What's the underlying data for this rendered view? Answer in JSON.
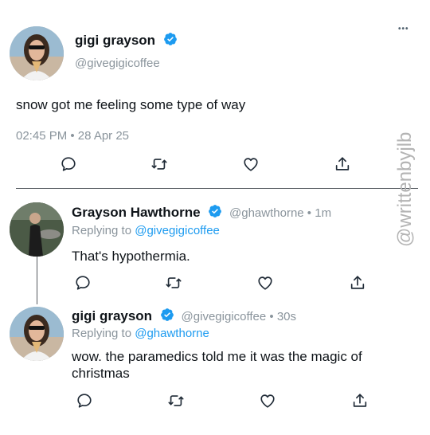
{
  "main_tweet": {
    "display_name": "gigi grayson",
    "handle": "@givegigicoffee",
    "text": "snow got me feeling some type of way",
    "timestamp": "02:45 PM • 28 Apr 25",
    "more_label": "•••"
  },
  "reply_1": {
    "display_name": "Grayson Hawthorne",
    "handle_time": "@ghawthorne • 1m",
    "replying_prefix": "Replying to",
    "replying_handle": "@givegigicoffee",
    "text": "That's hypothermia."
  },
  "reply_2": {
    "display_name": "gigi grayson",
    "handle_time": "@givegigicoffee • 30s",
    "replying_prefix": "Replying to",
    "replying_handle": "@ghawthorne",
    "text": "wow. the paramedics told me it was the magic of christmas"
  },
  "watermark": "@writtenbyjlb",
  "colors": {
    "verified": "#1d9bf0",
    "mention": "#1d9bf0",
    "muted": "#8a949c",
    "icon": "#1f2a36"
  },
  "icons": [
    "comment-icon",
    "retweet-icon",
    "like-icon",
    "share-icon",
    "verified-badge-icon",
    "more-icon"
  ]
}
